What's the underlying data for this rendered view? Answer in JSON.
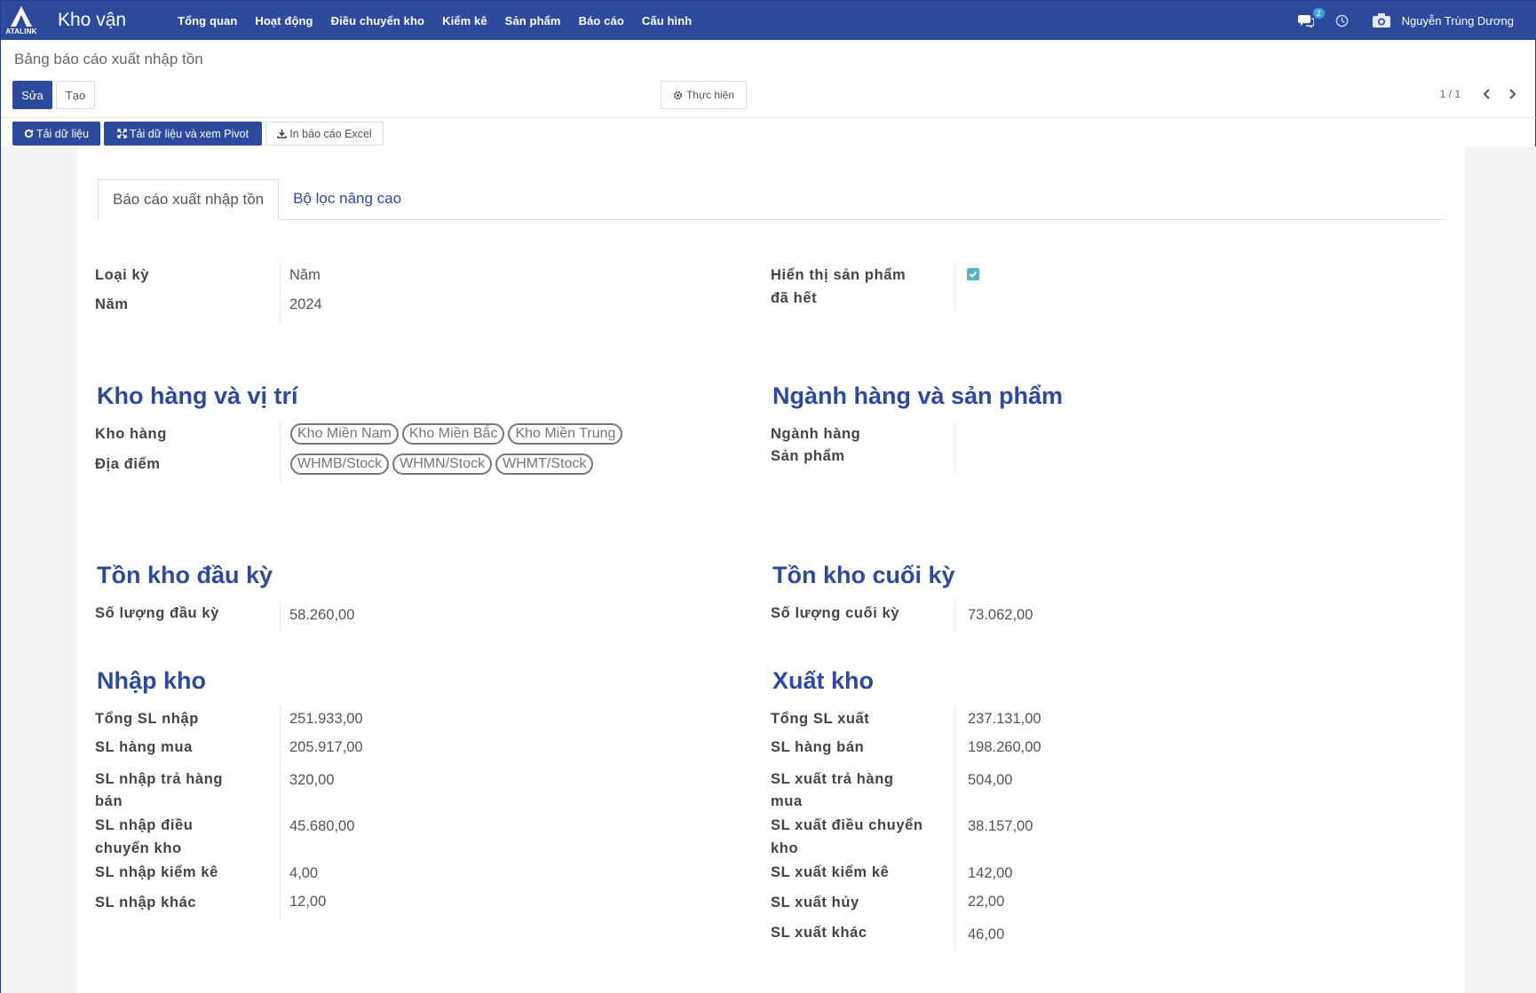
{
  "navbar": {
    "logo_text": "ATALINK",
    "app_title": "Kho vận",
    "menu": [
      "Tổng quan",
      "Hoạt động",
      "Điều chuyển kho",
      "Kiểm kê",
      "Sản phẩm",
      "Báo cáo",
      "Cấu hình"
    ],
    "chat_count": "2",
    "user_name": "Nguyễn Trùng Dương"
  },
  "control": {
    "breadcrumb": "Bảng báo cáo xuất nhập tồn",
    "edit_label": "Sửa",
    "create_label": "Tạo",
    "execute_label": "Thực hiện",
    "pager": "1 / 1",
    "reload_label": "Tải dữ liệu",
    "pivot_label": "Tải dữ liệu và xem Pivot",
    "excel_label": "In báo cáo Excel"
  },
  "tabs": [
    "Báo cáo xuất nhập tồn",
    "Bộ lọc nâng cao"
  ],
  "period": {
    "type_label": "Loại kỳ",
    "type_value": "Năm",
    "year_label": "Năm",
    "year_value": "2024",
    "show_empty_label_1": "Hiển thị sản phẩm",
    "show_empty_label_2": "đã hết",
    "show_empty_checked": true
  },
  "warehouse": {
    "title": "Kho hàng và vị trí",
    "warehouse_label": "Kho hàng",
    "warehouses": [
      "Kho Miền Nam",
      "Kho Miền Bắc",
      "Kho Miền Trung"
    ],
    "location_label": "Địa điểm",
    "locations": [
      "WHMB/Stock",
      "WHMN/Stock",
      "WHMT/Stock"
    ]
  },
  "category": {
    "title": "Ngành hàng và sản phẩm",
    "category_label": "Ngành hàng",
    "product_label": "Sản phẩm"
  },
  "opening": {
    "title": "Tồn kho đầu kỳ",
    "qty_label": "Số lượng đầu kỳ",
    "qty_value": "58.260,00"
  },
  "closing": {
    "title": "Tồn kho cuối kỳ",
    "qty_label": "Số lượng cuối kỳ",
    "qty_value": "73.062,00"
  },
  "incoming": {
    "title": "Nhập kho",
    "rows": [
      {
        "label": "Tổng SL nhập",
        "value": "251.933,00"
      },
      {
        "label": "SL hàng mua",
        "value": "205.917,00"
      },
      {
        "label": "SL nhập trả hàng",
        "label2": "bán",
        "value": "320,00"
      },
      {
        "label": "SL nhập điều",
        "label2": "chuyển kho",
        "value": "45.680,00"
      },
      {
        "label": "SL nhập kiểm kê",
        "value": "4,00"
      },
      {
        "label": "SL nhập khác",
        "value": "12,00"
      }
    ]
  },
  "outgoing": {
    "title": "Xuất kho",
    "rows": [
      {
        "label": "Tổng SL xuất",
        "value": "237.131,00"
      },
      {
        "label": "SL hàng bán",
        "value": "198.260,00"
      },
      {
        "label": "SL xuất trả hàng",
        "label2": "mua",
        "value": "504,00"
      },
      {
        "label": "SL xuất điều chuyển",
        "label2": "kho",
        "value": "38.157,00"
      },
      {
        "label": "SL xuất kiểm kê",
        "value": "142,00"
      },
      {
        "label": "SL xuất hủy",
        "value": "22,00"
      },
      {
        "label": "SL xuất khác",
        "value": "46,00"
      }
    ]
  }
}
